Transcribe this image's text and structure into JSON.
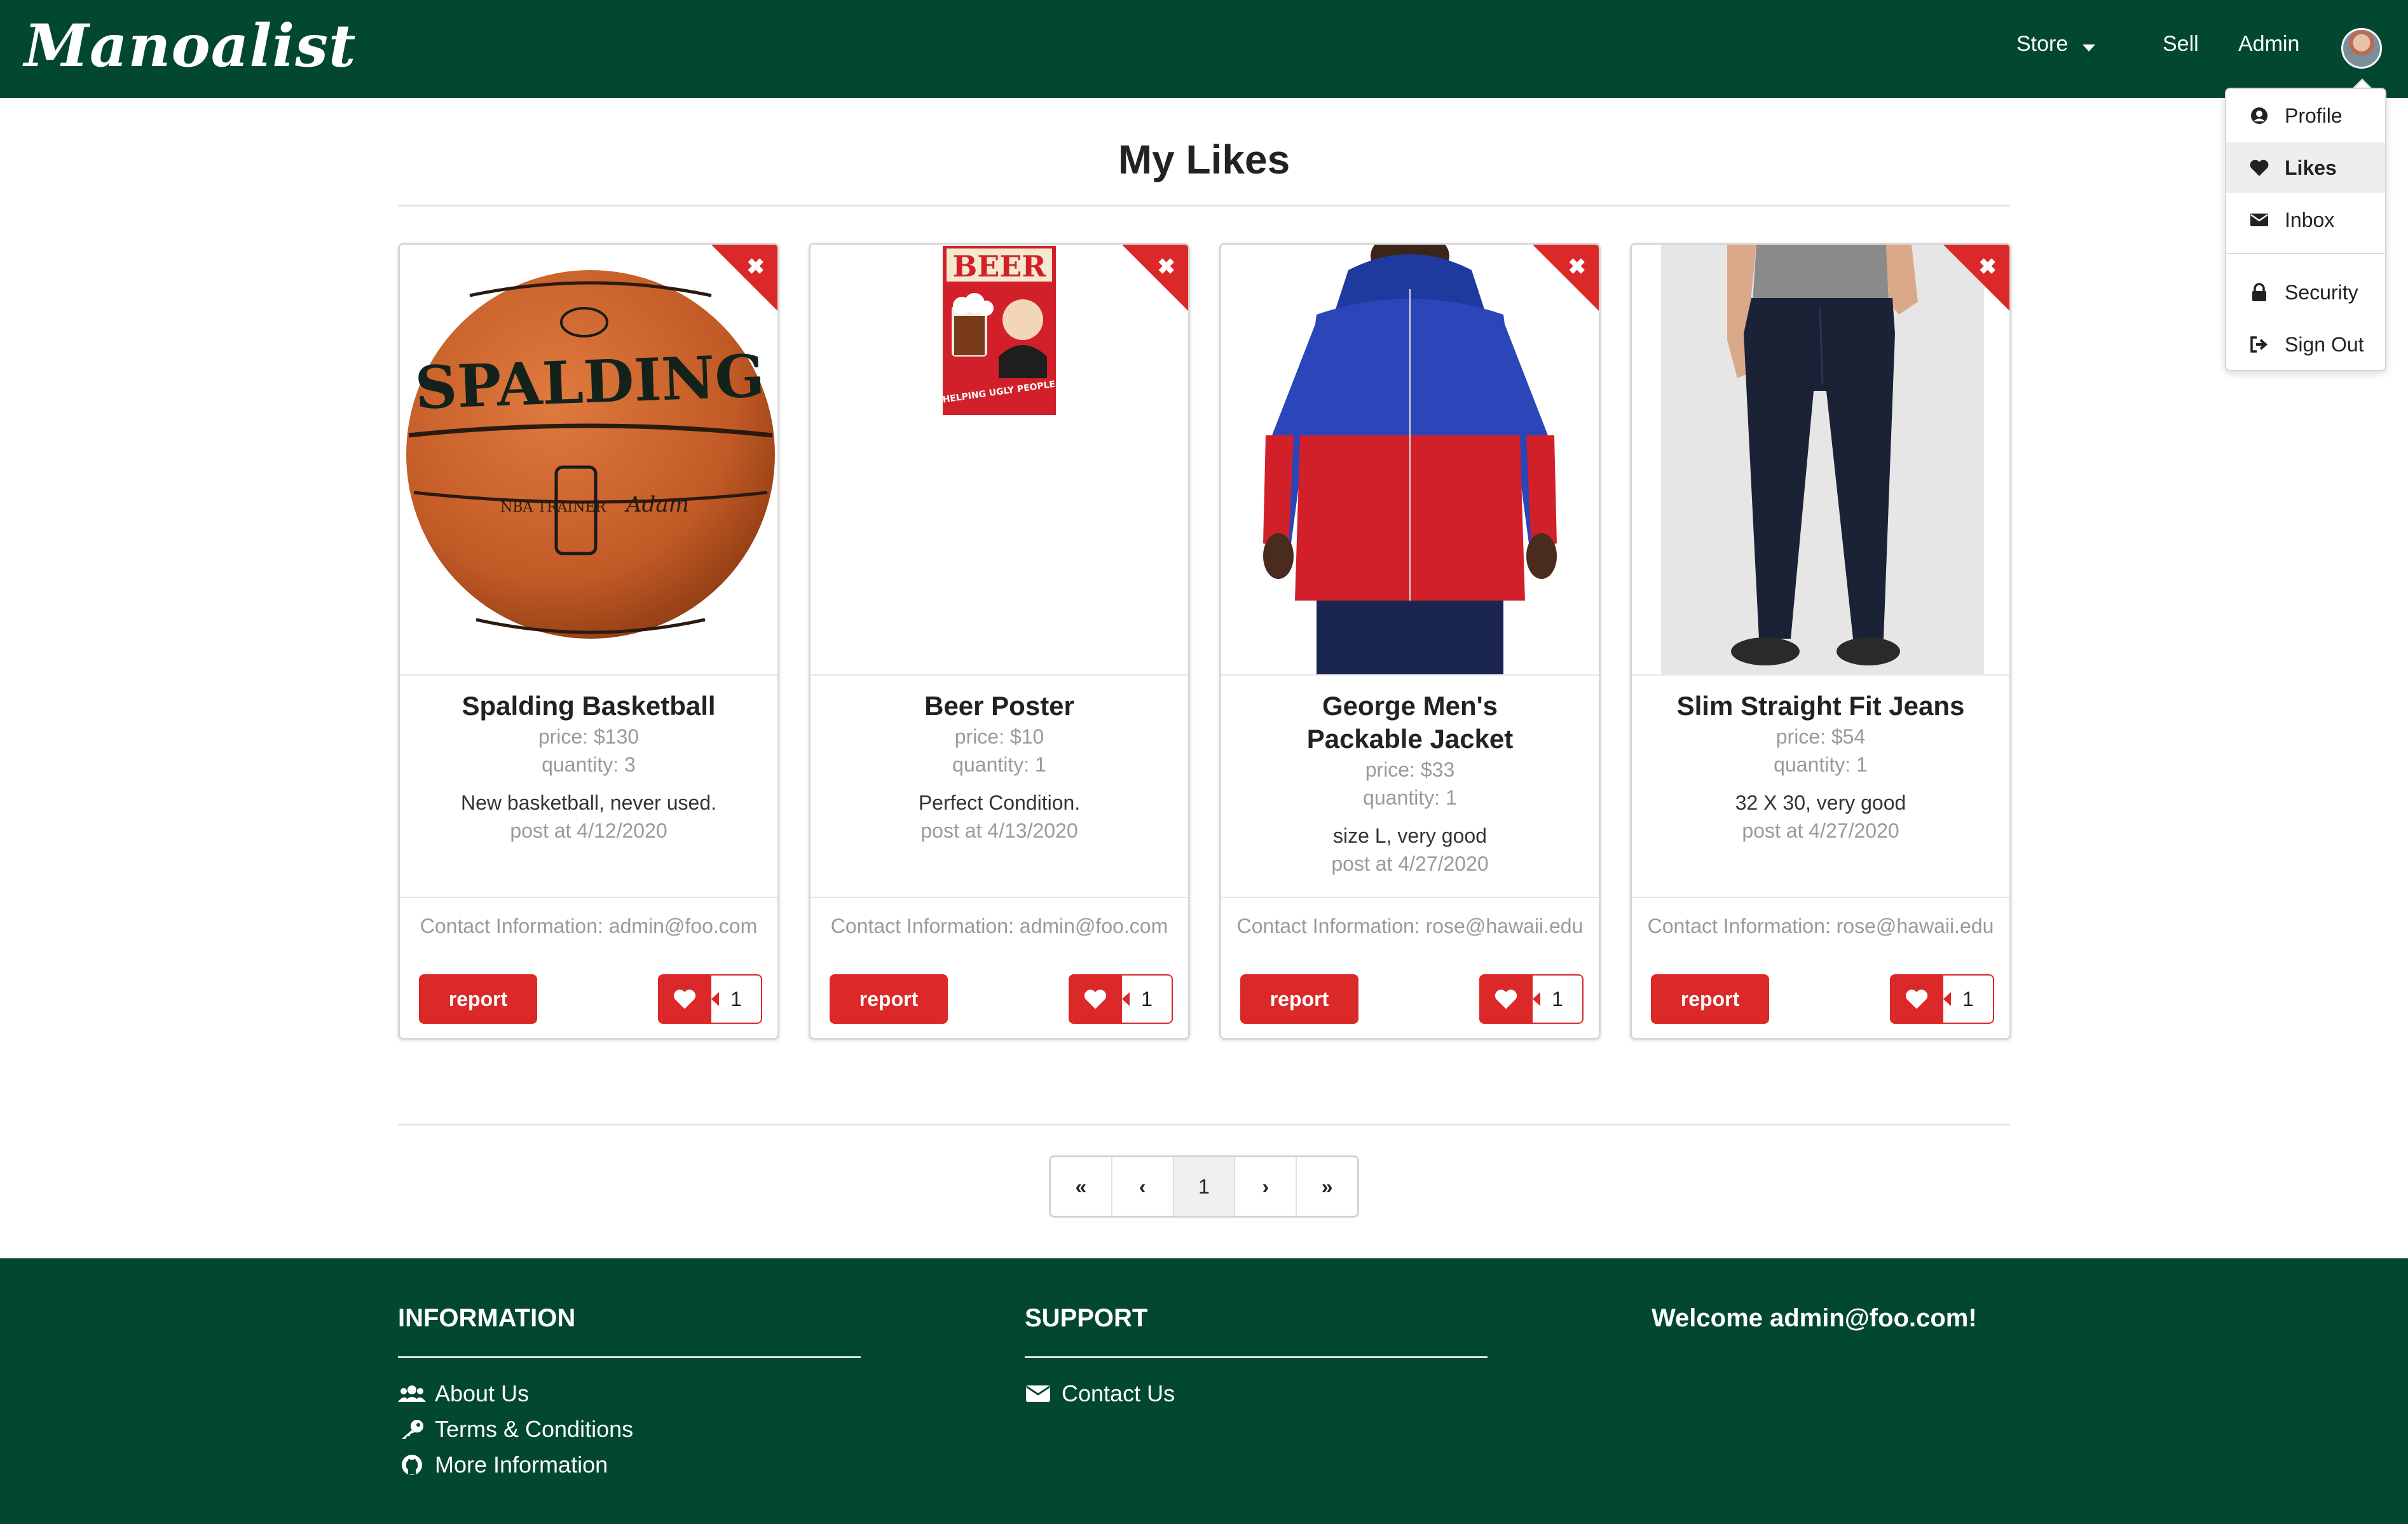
{
  "navbar": {
    "logo": "Manoalist",
    "store_label": "Store",
    "sell_label": "Sell",
    "admin_label": "Admin"
  },
  "dropdown": {
    "items": [
      {
        "label": "Profile",
        "icon": "user-circle-icon"
      },
      {
        "label": "Likes",
        "icon": "heart-icon",
        "active": true
      },
      {
        "label": "Inbox",
        "icon": "envelope-icon"
      },
      {
        "label": "Security",
        "icon": "lock-icon"
      },
      {
        "label": "Sign Out",
        "icon": "sign-out-icon"
      }
    ]
  },
  "page": {
    "title": "My Likes"
  },
  "cards": [
    {
      "title": "Spalding Basketball",
      "price": "price: $130",
      "quantity": "quantity: 3",
      "description": "New basketball, never used.",
      "posted": "post at 4/12/2020",
      "contact": "Contact Information: admin@foo.com",
      "report_label": "report",
      "likes": "1",
      "image": "basketball",
      "image_text": "SPALDING"
    },
    {
      "title": "Beer Poster",
      "price": "price: $10",
      "quantity": "quantity: 1",
      "description": "Perfect Condition.",
      "posted": "post at 4/13/2020",
      "contact": "Contact Information: admin@foo.com",
      "report_label": "report",
      "likes": "1",
      "image": "poster",
      "image_text": "BEER"
    },
    {
      "title": "George Men's Packable Jacket",
      "price": "price: $33",
      "quantity": "quantity: 1",
      "description": "size L, very good",
      "posted": "post at 4/27/2020",
      "contact": "Contact Information: rose@hawaii.edu",
      "report_label": "report",
      "likes": "1",
      "image": "jacket"
    },
    {
      "title": "Slim Straight Fit Jeans",
      "price": "price: $54",
      "quantity": "quantity: 1",
      "description": "32 X 30, very good",
      "posted": "post at 4/27/2020",
      "contact": "Contact Information: rose@hawaii.edu",
      "report_label": "report",
      "likes": "1",
      "image": "jeans"
    }
  ],
  "pagination": {
    "first": "«",
    "prev": "‹",
    "current": "1",
    "next": "›",
    "last": "»"
  },
  "footer": {
    "information": {
      "heading": "INFORMATION",
      "links": [
        "About Us",
        "Terms & Conditions",
        "More Information"
      ]
    },
    "support": {
      "heading": "SUPPORT",
      "links": [
        "Contact Us"
      ]
    },
    "welcome": "Welcome admin@foo.com!"
  },
  "colors": {
    "brand_green": "#024731",
    "accent_red": "#db2828"
  }
}
